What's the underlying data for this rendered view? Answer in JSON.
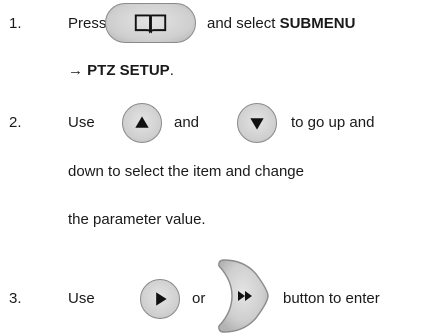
{
  "steps": [
    {
      "number": "1.",
      "lines": [
        {
          "pre": "Press",
          "post": "and select",
          "post_bold": "SUBMENU"
        },
        {
          "bold": "→ PTZ SETUP",
          "tail": "."
        }
      ],
      "icons": [
        "book-icon"
      ]
    },
    {
      "number": "2.",
      "lines": [
        {
          "pre": "Use",
          "mid": "and",
          "post": "to go up and"
        },
        {
          "text": "down to select the item and change"
        },
        {
          "text": "the parameter value."
        }
      ],
      "icons": [
        "up-triangle-icon",
        "down-triangle-icon"
      ]
    },
    {
      "number": "3.",
      "lines": [
        {
          "pre": "Use",
          "mid": "or",
          "post": "button to enter"
        }
      ],
      "icons": [
        "play-triangle-icon",
        "fast-forward-icon"
      ]
    }
  ],
  "colors": {
    "button_fill": "#cfcfcf",
    "button_border": "#8a8a8a",
    "glyph": "#111111"
  }
}
